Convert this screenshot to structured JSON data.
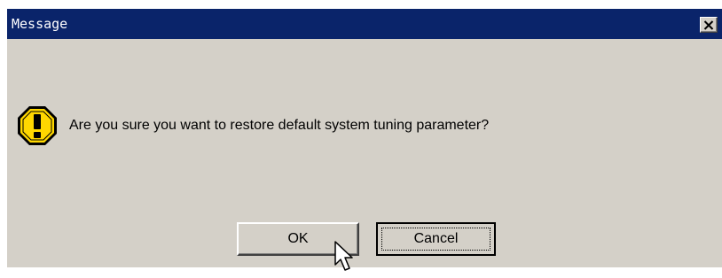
{
  "window": {
    "title": "Message",
    "close_symbol": "✕"
  },
  "icon": {
    "name": "warning-icon",
    "symbol": "!",
    "colors": {
      "fill": "#ffd700",
      "outline": "#000000"
    }
  },
  "message": {
    "text": "Are you sure you want to restore default system tuning parameter?"
  },
  "buttons": {
    "ok_label": "OK",
    "cancel_label": "Cancel"
  },
  "colors": {
    "titlebar": "#0a246a",
    "dialog_bg": "#d4d0c8",
    "title_text": "#ffffff"
  }
}
